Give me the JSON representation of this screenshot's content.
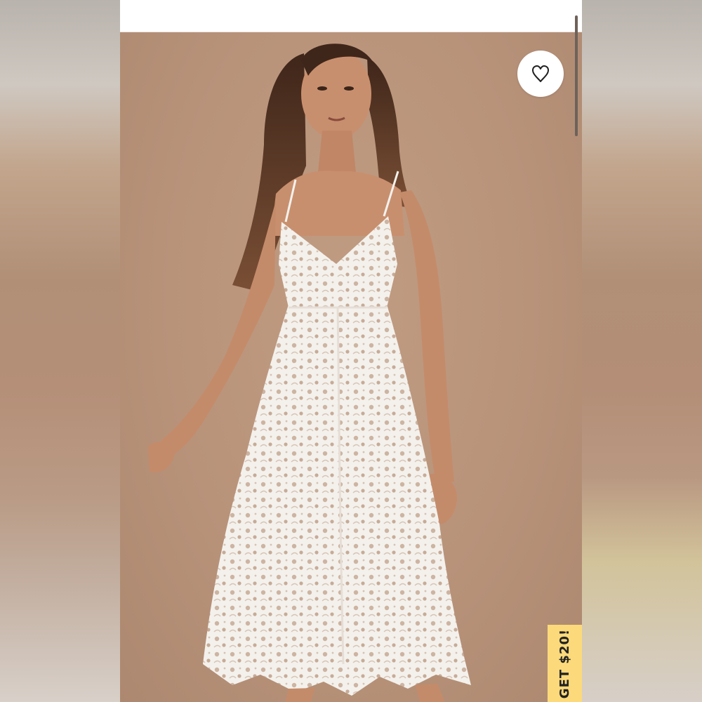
{
  "colors": {
    "backdrop": "#b9937a",
    "promo_tab_bg": "#fcd97a",
    "dress": "#f4f1ec",
    "skin": "#c88f6e",
    "hair": "#4a2d1e"
  },
  "product_image": {
    "favorite_button_icon": "heart-outline-icon"
  },
  "promo_tab": {
    "label": "GET $20!"
  }
}
